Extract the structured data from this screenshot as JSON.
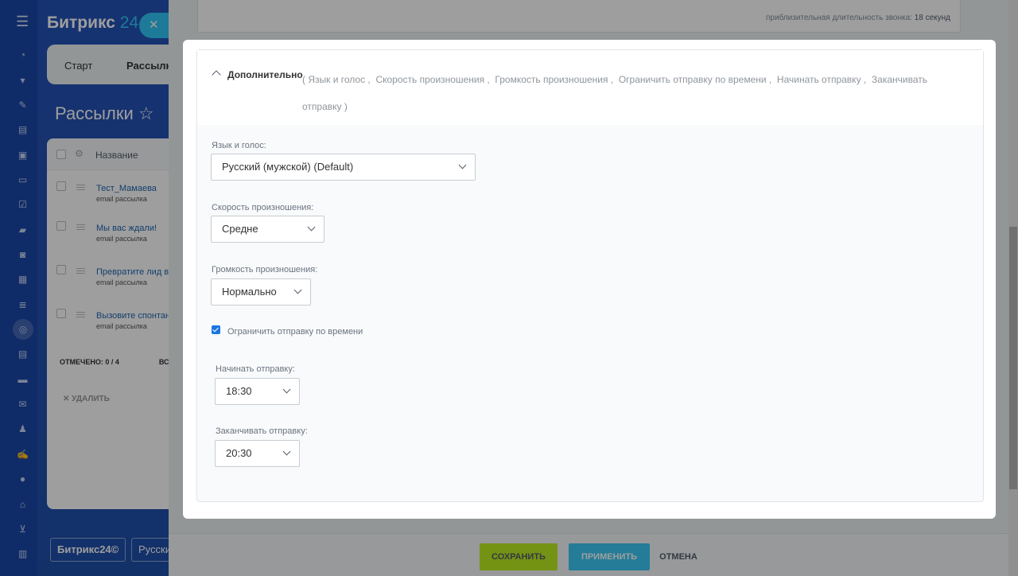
{
  "background": {
    "brand": "Битрикс",
    "brand_num": "24",
    "close_symbol": "✕",
    "tabs": [
      "Старт",
      "Рассылки"
    ],
    "page_title": "Рассылки",
    "star_icon": "☆",
    "column_header": "Название",
    "rows": [
      {
        "title": "Тест_Мамаева",
        "sub": "email рассылка"
      },
      {
        "title": "Мы вас ждали!",
        "sub": "email рассылка"
      },
      {
        "title": "Превратите лид в",
        "sub": "email рассылка"
      },
      {
        "title": "Вызовите спонтанн",
        "sub": "email рассылка"
      }
    ],
    "selected_label": "ОТМЕЧЕНО: 0 / 4",
    "selected_extra": "ВС",
    "delete_label": "✕ УДАЛИТЬ",
    "footer_brand": "Битрикс24©",
    "footer_lang": "Русский"
  },
  "slider": {
    "call_duration_label": "приблизительная длительность звонка:",
    "call_duration_value": "18 секунд",
    "buttons": {
      "save": "СОХРАНИТЬ",
      "apply": "ПРИМЕНИТЬ",
      "cancel": "ОТМЕНА"
    }
  },
  "modal": {
    "section_title": "Дополнительно",
    "summary": {
      "open": "(",
      "items": [
        "Язык и голос ,",
        "Скорость произношения ,",
        "Громкость произношения ,",
        "Ограничить отправку по времени ,",
        "Начинать отправку ,",
        "Заканчивать"
      ],
      "tail": "отправку  )"
    },
    "voice": {
      "label": "Язык и голос:",
      "value": "Русский (мужской) (Default)"
    },
    "speed": {
      "label": "Скорость произношения:",
      "value": "Средне"
    },
    "volume": {
      "label": "Громкость произношения:",
      "value": "Нормально"
    },
    "limit_time": {
      "label": "Ограничить отправку по времени",
      "checked": true
    },
    "start": {
      "label": "Начинать отправку:",
      "value": "18:30"
    },
    "end": {
      "label": "Заканчивать отправку:",
      "value": "20:30"
    }
  },
  "colors": {
    "accent_blue": "#2fc6f6",
    "save_green": "#bbed21",
    "apply_blue": "#3bc8f5",
    "checkbox_blue": "#1b74e4"
  }
}
